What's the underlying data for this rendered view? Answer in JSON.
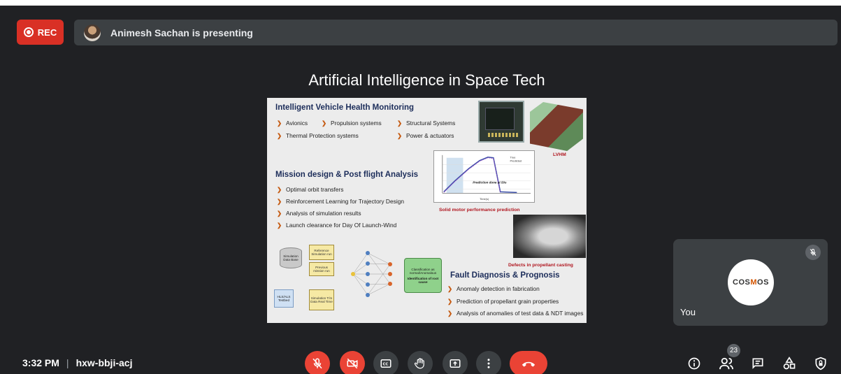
{
  "top_bar": {
    "rec_label": "REC",
    "presenter_text": "Animesh Sachan is presenting"
  },
  "slide": {
    "title": "Artificial Intelligence in Space Tech",
    "section1": {
      "heading": "Intelligent Vehicle Health Monitoring",
      "items": [
        "Avionics",
        "Propulsion systems",
        "Structural Systems",
        "Thermal Protection systems",
        "Power & actuators"
      ]
    },
    "lvhm_label": "LVHM",
    "graph": {
      "legend": [
        "True",
        "Predicted"
      ],
      "annotation": "Prediction done at 50s",
      "xlabel": "Time(s)"
    },
    "graph_caption": "Solid motor performance prediction",
    "section2": {
      "heading": "Mission design & Post flight Analysis",
      "items": [
        "Optimal orbit transfers",
        "Reinforcement Learning for Trajectory Design",
        "Analysis of simulation results",
        "Launch clearance for Day Of Launch-Wind"
      ]
    },
    "casting_caption": "Defects in propellant casting",
    "diagram": {
      "db": "Simulation Data Base",
      "ref_sim": "Reference Simulation run",
      "prev_mission": "Previous mission run",
      "testbed": "HLS/ALS Testbed",
      "sim_data": "Simulation T/m Data Real Time",
      "classification": "Classification as normal/Anomalous",
      "root_cause": "Identification of root cause"
    },
    "section3": {
      "heading": "Fault Diagnosis & Prognosis",
      "items": [
        "Anomaly detection in fabrication",
        "Prediction of propellant grain properties",
        "Analysis of anomalies of test data & NDT images"
      ]
    }
  },
  "self_tile": {
    "name": "You",
    "logo_text_a": "COS",
    "logo_text_b": "M",
    "logo_text_c": "OS"
  },
  "bottom_bar": {
    "time": "3:32 PM",
    "separator": "|",
    "meeting_code": "hxw-bbji-acj",
    "participant_count": "23"
  },
  "colors": {
    "background": "#202124",
    "panel": "#3c4043",
    "danger": "#ea4335",
    "rec": "#d93025"
  }
}
